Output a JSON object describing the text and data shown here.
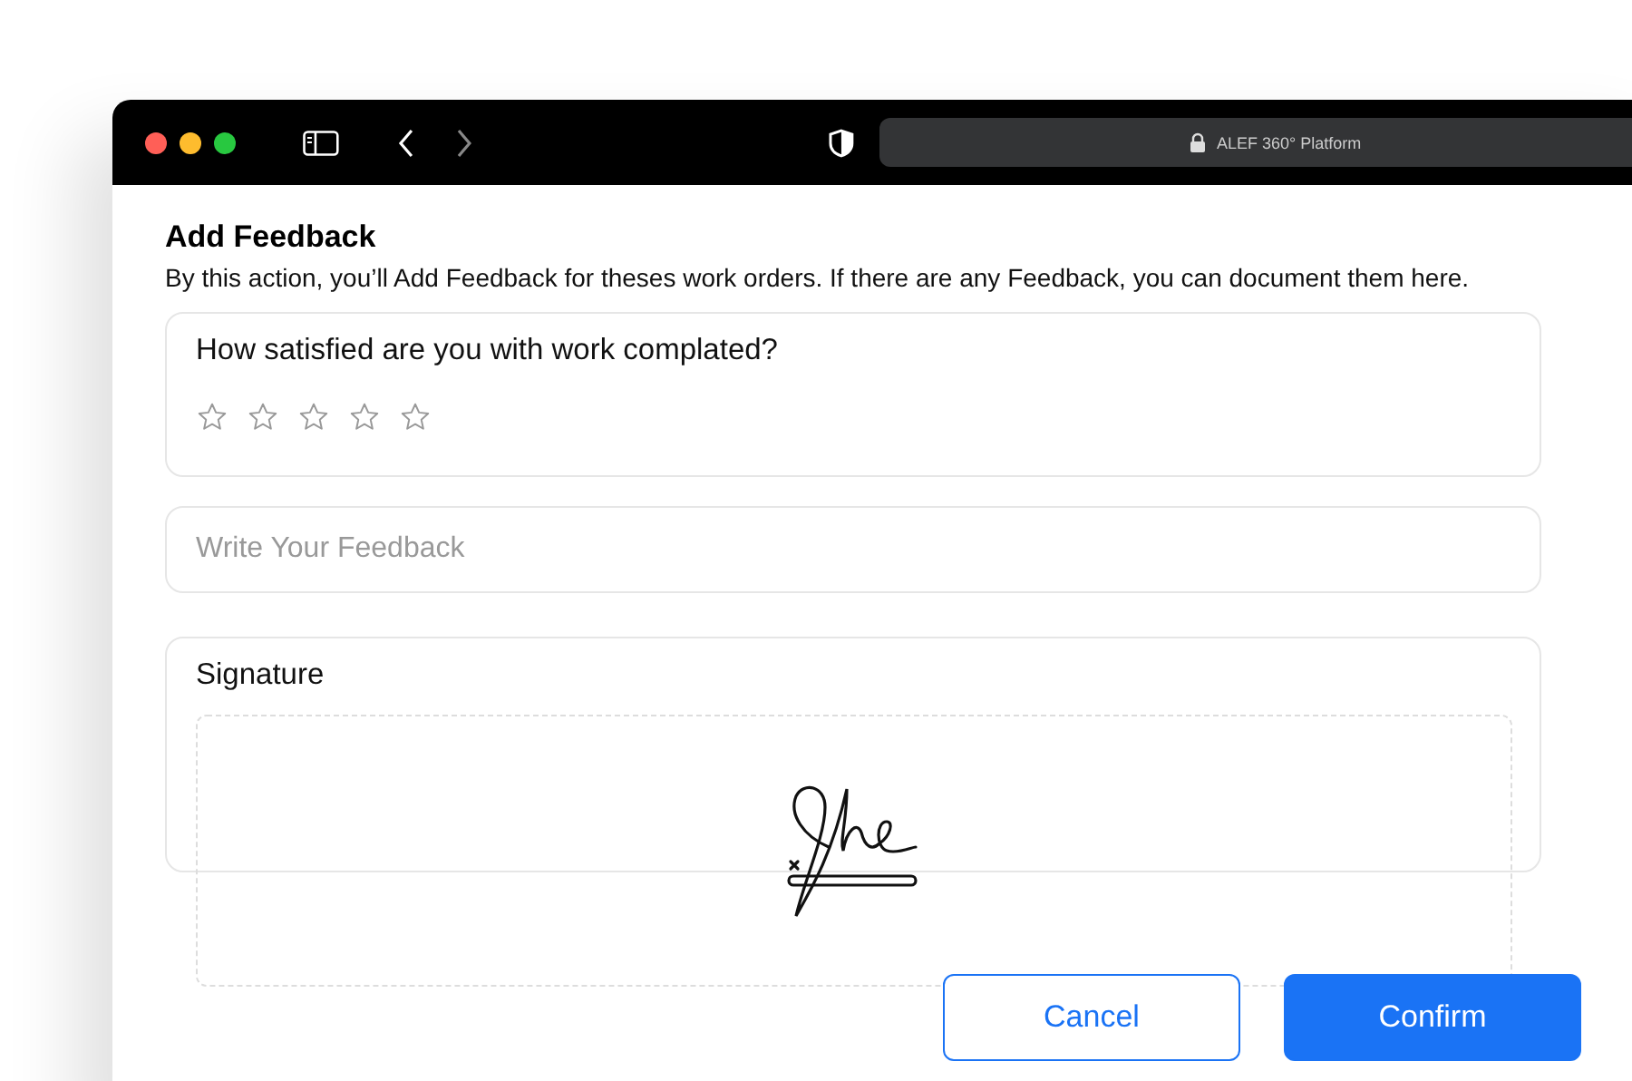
{
  "browser": {
    "address": "ALEF 360° Platform"
  },
  "dialog": {
    "title": "Add Feedback",
    "description": "By this action, you’ll Add Feedback for theses work orders. If there are any Feedback, you can document them here.",
    "rating": {
      "question": "How satisfied are you with work complated?",
      "stars": 0
    },
    "feedback": {
      "placeholder": "Write Your Feedback"
    },
    "signature": {
      "label": "Signature"
    },
    "buttons": [
      {
        "label": "Cancel",
        "kind": "secondary"
      },
      {
        "label": "Confirm",
        "kind": "primary"
      }
    ]
  }
}
